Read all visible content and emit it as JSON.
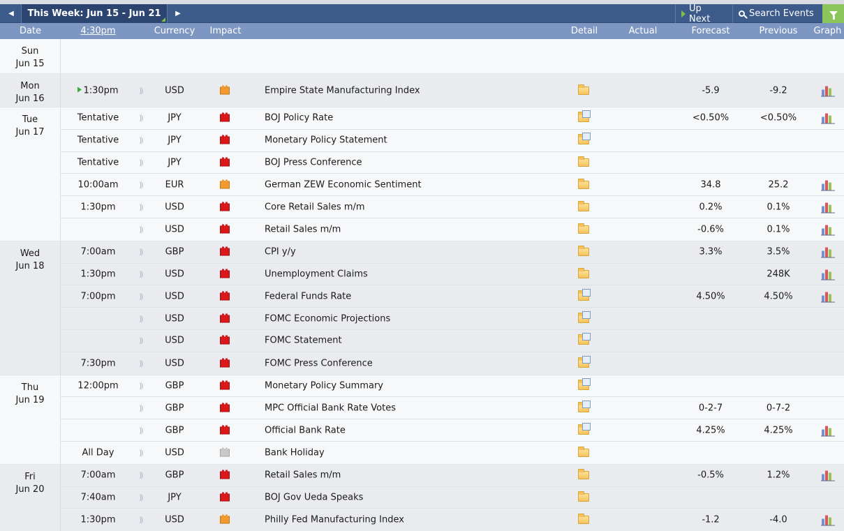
{
  "toolbar": {
    "week_label": "This Week: Jun 15 - Jun 21",
    "up_next": "Up Next",
    "search": "Search Events"
  },
  "header": {
    "date": "Date",
    "time": "4:30pm",
    "currency": "Currency",
    "impact": "Impact",
    "detail": "Detail",
    "actual": "Actual",
    "forecast": "Forecast",
    "previous": "Previous",
    "graph": "Graph"
  },
  "days": [
    {
      "dow": "Sun",
      "date": "Jun 15",
      "events": []
    },
    {
      "dow": "Mon",
      "date": "Jun 16",
      "events": [
        {
          "time": "1:30pm",
          "next": true,
          "currency": "USD",
          "impact": "medium",
          "event": "Empire State Manufacturing Index",
          "detail": "folder",
          "actual": "",
          "forecast": "-5.9",
          "previous": "-9.2",
          "graph": true
        }
      ]
    },
    {
      "dow": "Tue",
      "date": "Jun 17",
      "events": [
        {
          "time": "Tentative",
          "currency": "JPY",
          "impact": "high",
          "event": "BOJ Policy Rate",
          "detail": "doc",
          "actual": "",
          "forecast": "<0.50%",
          "previous": "<0.50%",
          "graph": true
        },
        {
          "time": "Tentative",
          "currency": "JPY",
          "impact": "high",
          "event": "Monetary Policy Statement",
          "detail": "doc",
          "actual": "",
          "forecast": "",
          "previous": "",
          "graph": false
        },
        {
          "time": "Tentative",
          "currency": "JPY",
          "impact": "high",
          "event": "BOJ Press Conference",
          "detail": "folder",
          "actual": "",
          "forecast": "",
          "previous": "",
          "graph": false
        },
        {
          "time": "10:00am",
          "currency": "EUR",
          "impact": "medium",
          "event": "German ZEW Economic Sentiment",
          "detail": "folder",
          "actual": "",
          "forecast": "34.8",
          "previous": "25.2",
          "graph": true
        },
        {
          "time": "1:30pm",
          "currency": "USD",
          "impact": "high",
          "event": "Core Retail Sales m/m",
          "detail": "folder",
          "actual": "",
          "forecast": "0.2%",
          "previous": "0.1%",
          "graph": true
        },
        {
          "time": "",
          "currency": "USD",
          "impact": "high",
          "event": "Retail Sales m/m",
          "detail": "folder",
          "actual": "",
          "forecast": "-0.6%",
          "previous": "0.1%",
          "graph": true
        }
      ]
    },
    {
      "dow": "Wed",
      "date": "Jun 18",
      "events": [
        {
          "time": "7:00am",
          "currency": "GBP",
          "impact": "high",
          "event": "CPI y/y",
          "detail": "folder",
          "actual": "",
          "forecast": "3.3%",
          "previous": "3.5%",
          "graph": true
        },
        {
          "time": "1:30pm",
          "currency": "USD",
          "impact": "high",
          "event": "Unemployment Claims",
          "detail": "folder",
          "actual": "",
          "forecast": "",
          "previous": "248K",
          "graph": true
        },
        {
          "time": "7:00pm",
          "currency": "USD",
          "impact": "high",
          "event": "Federal Funds Rate",
          "detail": "doc",
          "actual": "",
          "forecast": "4.50%",
          "previous": "4.50%",
          "graph": true
        },
        {
          "time": "",
          "currency": "USD",
          "impact": "high",
          "event": "FOMC Economic Projections",
          "detail": "doc",
          "actual": "",
          "forecast": "",
          "previous": "",
          "graph": false
        },
        {
          "time": "",
          "currency": "USD",
          "impact": "high",
          "event": "FOMC Statement",
          "detail": "doc",
          "actual": "",
          "forecast": "",
          "previous": "",
          "graph": false
        },
        {
          "time": "7:30pm",
          "currency": "USD",
          "impact": "high",
          "event": "FOMC Press Conference",
          "detail": "doc",
          "actual": "",
          "forecast": "",
          "previous": "",
          "graph": false
        }
      ]
    },
    {
      "dow": "Thu",
      "date": "Jun 19",
      "events": [
        {
          "time": "12:00pm",
          "currency": "GBP",
          "impact": "high",
          "event": "Monetary Policy Summary",
          "detail": "doc",
          "actual": "",
          "forecast": "",
          "previous": "",
          "graph": false
        },
        {
          "time": "",
          "currency": "GBP",
          "impact": "high",
          "event": "MPC Official Bank Rate Votes",
          "detail": "doc",
          "actual": "",
          "forecast": "0-2-7",
          "previous": "0-7-2",
          "graph": false
        },
        {
          "time": "",
          "currency": "GBP",
          "impact": "high",
          "event": "Official Bank Rate",
          "detail": "doc",
          "actual": "",
          "forecast": "4.25%",
          "previous": "4.25%",
          "graph": true
        },
        {
          "time": "All Day",
          "currency": "USD",
          "impact": "holiday",
          "event": "Bank Holiday",
          "detail": "folder",
          "actual": "",
          "forecast": "",
          "previous": "",
          "graph": false
        }
      ]
    },
    {
      "dow": "Fri",
      "date": "Jun 20",
      "events": [
        {
          "time": "7:00am",
          "currency": "GBP",
          "impact": "high",
          "event": "Retail Sales m/m",
          "detail": "folder",
          "actual": "",
          "forecast": "-0.5%",
          "previous": "1.2%",
          "graph": true
        },
        {
          "time": "7:40am",
          "currency": "JPY",
          "impact": "high",
          "event": "BOJ Gov Ueda Speaks",
          "detail": "folder",
          "actual": "",
          "forecast": "",
          "previous": "",
          "graph": false
        },
        {
          "time": "1:30pm",
          "currency": "USD",
          "impact": "medium",
          "event": "Philly Fed Manufacturing Index",
          "detail": "folder",
          "actual": "",
          "forecast": "-1.2",
          "previous": "-4.0",
          "graph": true
        }
      ]
    }
  ],
  "colors": {
    "toolbar": "#3c5a8a",
    "header": "#7d96c2",
    "impact_high": "#d8191b",
    "impact_medium": "#f29a2e",
    "impact_holiday": "#c9c9c9",
    "filter": "#8cc65a"
  }
}
